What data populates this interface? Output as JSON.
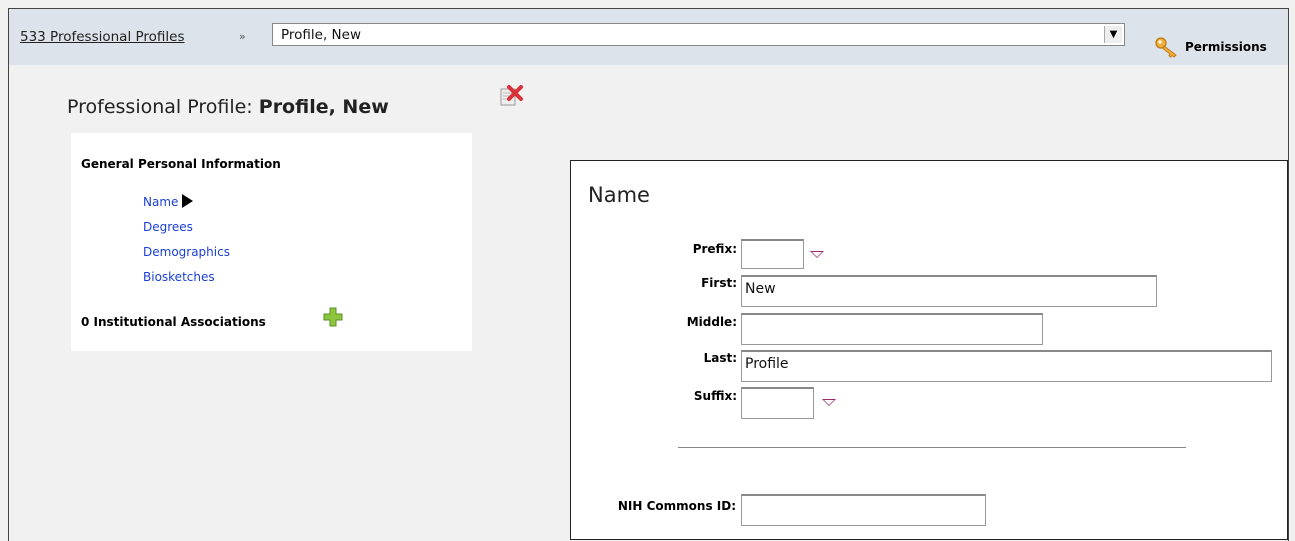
{
  "header": {
    "breadcrumb": "533 Professional Profiles",
    "separator": "»",
    "profile_select_value": "Profile, New",
    "permissions_label": "Permissions"
  },
  "page": {
    "title_prefix": "Professional Profile:",
    "title_name": "Profile, New"
  },
  "sidebar": {
    "section_title": "General Personal Information",
    "items": [
      {
        "label": "Name",
        "active": true
      },
      {
        "label": "Degrees"
      },
      {
        "label": "Demographics"
      },
      {
        "label": "Biosketches"
      }
    ],
    "institutional_label": "0 Institutional Associations"
  },
  "form": {
    "title": "Name",
    "prefix_label": "Prefix:",
    "prefix_value": "",
    "first_label": "First:",
    "first_value": "New",
    "middle_label": "Middle:",
    "middle_value": "",
    "last_label": "Last:",
    "last_value": "Profile",
    "suffix_label": "Suffix:",
    "suffix_value": "",
    "nih_label": "NIH Commons ID:",
    "nih_value": ""
  },
  "icons": {
    "permissions": "key-icon",
    "delete": "delete-icon",
    "add": "plus-icon",
    "active_item": "arrow-right-icon"
  }
}
